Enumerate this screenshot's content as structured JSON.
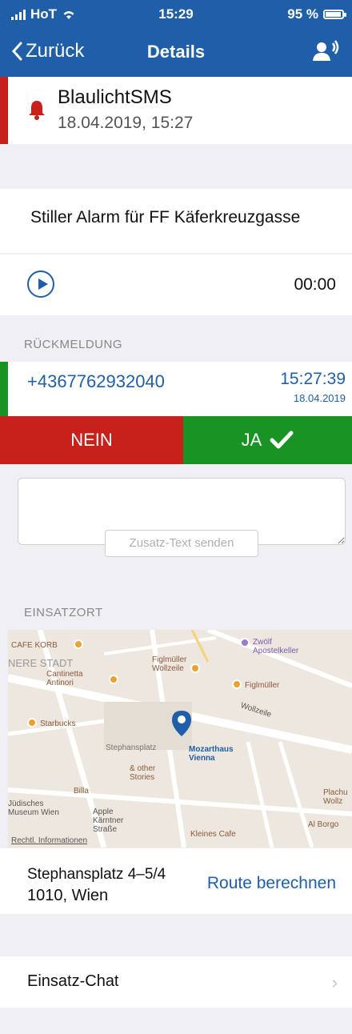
{
  "status": {
    "carrier": "HoT",
    "time": "15:29",
    "battery": "95 %"
  },
  "nav": {
    "back_label": "Zurück",
    "title": "Details"
  },
  "alarm": {
    "title": "BlaulichtSMS",
    "date": "18.04.2019, 15:27"
  },
  "message": "Stiller Alarm für FF Käferkreuzgasse",
  "audio": {
    "time": "00:00"
  },
  "response": {
    "section": "RÜCKMELDUNG",
    "phone": "+4367762932040",
    "time": "15:27:39",
    "date": "18.04.2019",
    "no_label": "NEIN",
    "yes_label": "JA"
  },
  "extra_text": {
    "button": "Zusatz-Text senden"
  },
  "location": {
    "section": "EINSATZORT",
    "map_labels": [
      "CAFE KORB",
      "NERE STADT",
      "Zwölf Apostelkeller",
      "Figlmüller Wollzeile",
      "Figlmüller",
      "Cantinetta Antinori",
      "Starbucks",
      "Wollzeile",
      "Stephansplatz",
      "Mozarthaus Vienna",
      "& other Stories",
      "Billa",
      "Jüdisches Museum Wien",
      "Apple Kärntner Straße",
      "Kleines Cafe",
      "Al Borgo",
      "Plachu Wollz",
      "Rechtl. Informationen"
    ],
    "address_line1": "Stephansplatz 4–5/4",
    "address_line2": "1010, Wien",
    "route_label": "Route berechnen"
  },
  "chat": {
    "label": "Einsatz-Chat"
  },
  "colors": {
    "primary": "#1f5fa8",
    "red": "#c8201b",
    "green": "#199324"
  }
}
